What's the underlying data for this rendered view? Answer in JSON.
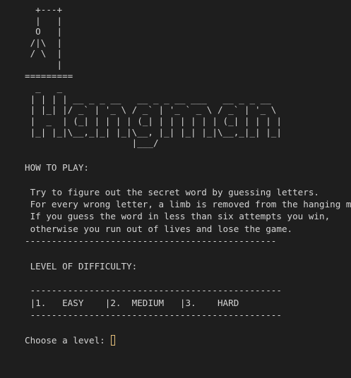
{
  "terminal": {
    "gallows": [
      "  +---+",
      "  |   |",
      "  O   |",
      " /|\\  |",
      " / \\  |",
      "      |",
      "========="
    ],
    "banner": [
      "  _   _",
      " | | | | __ _ _ __   __ _ _ __ ___   __ _ _ __",
      " | |_| |/ _` | '_ \\ / _` | '_ ` _ \\ / _` | '_ \\",
      " |  _  | (_| | | | | (_| | | | | | | (_| | | | |",
      " |_| |_|\\__,_|_| |_|\\__, |_| |_| |_|\\__,_|_| |_|",
      "                    |___/"
    ],
    "how_to_play_heading": "HOW TO PLAY:",
    "instructions": [
      " Try to figure out the secret word by guessing letters.",
      " For every wrong letter, a limb is removed from the hanging man.",
      " If you guess the word in less than six attempts you win,",
      " otherwise you run out of lives and lose the game."
    ],
    "separator": "-----------------------------------------------",
    "difficulty_heading": " LEVEL OF DIFFICULTY:",
    "level_separator": " -----------------------------------------------",
    "levels_row": " |1.   EASY    |2.  MEDIUM   |3.    HARD",
    "prompt": "Choose a level: "
  }
}
